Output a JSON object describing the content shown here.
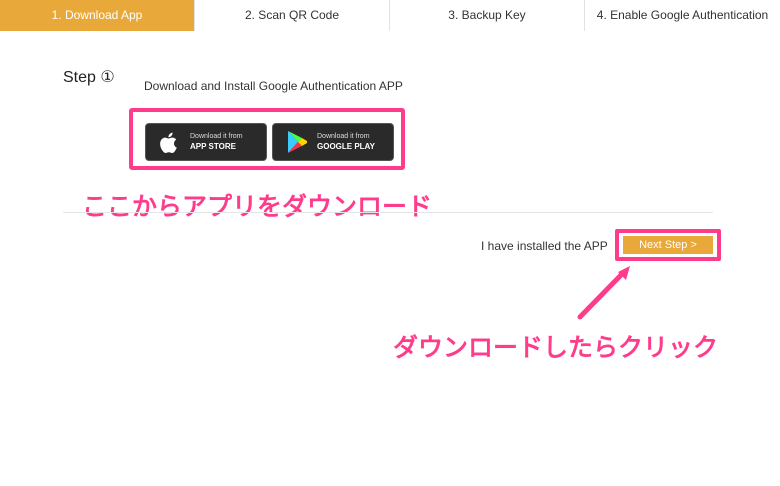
{
  "tabs": [
    {
      "label": "1. Download App",
      "active": true
    },
    {
      "label": "2. Scan QR Code",
      "active": false
    },
    {
      "label": "3. Backup Key",
      "active": false
    },
    {
      "label": "4. Enable Google Authentication",
      "active": false
    }
  ],
  "step": {
    "title": "Step ①",
    "description": "Download and Install Google Authentication APP"
  },
  "stores": {
    "apple": {
      "small": "Download it from",
      "big": "APP STORE",
      "icon": "apple-icon"
    },
    "google": {
      "small": "Download it from",
      "big": "GOOGLE PLAY",
      "icon": "google-play-icon"
    }
  },
  "annotations": {
    "download_here": "ここからアプリをダウンロード",
    "click_after": "ダウンロードしたらクリック"
  },
  "footer": {
    "installed_label": "I have installed the APP",
    "next_button": "Next Step >"
  },
  "colors": {
    "accent": "#e9a83a",
    "highlight": "#ff3c8c"
  }
}
